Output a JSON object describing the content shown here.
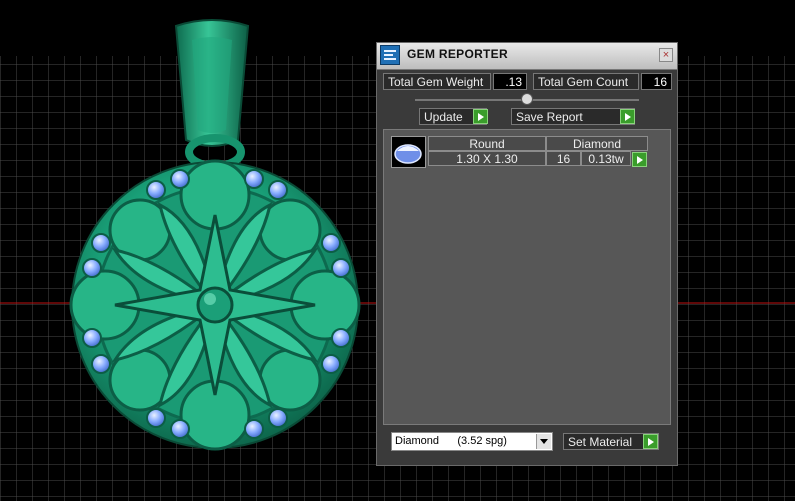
{
  "panel": {
    "title": "GEM REPORTER",
    "close_glyph": "×",
    "icon": "gem-reporter-app-icon"
  },
  "stats": {
    "total_weight_label": "Total Gem Weight",
    "total_weight_value": ".13",
    "total_count_label": "Total Gem Count",
    "total_count_value": "16"
  },
  "actions": {
    "update_label": "Update",
    "save_report_label": "Save Report"
  },
  "report": {
    "headers": [
      "Round",
      "Diamond"
    ],
    "rows": [
      {
        "size": "1.30 X 1.30",
        "count": "16",
        "weight": "0.13tw"
      }
    ]
  },
  "material": {
    "selected": "Diamond      (3.52 spg)",
    "set_label": "Set Material"
  },
  "colors": {
    "pendant_green": "#1f9a74",
    "gem_blue": "#7fa8ff",
    "accent_green": "#3a9d2b"
  }
}
